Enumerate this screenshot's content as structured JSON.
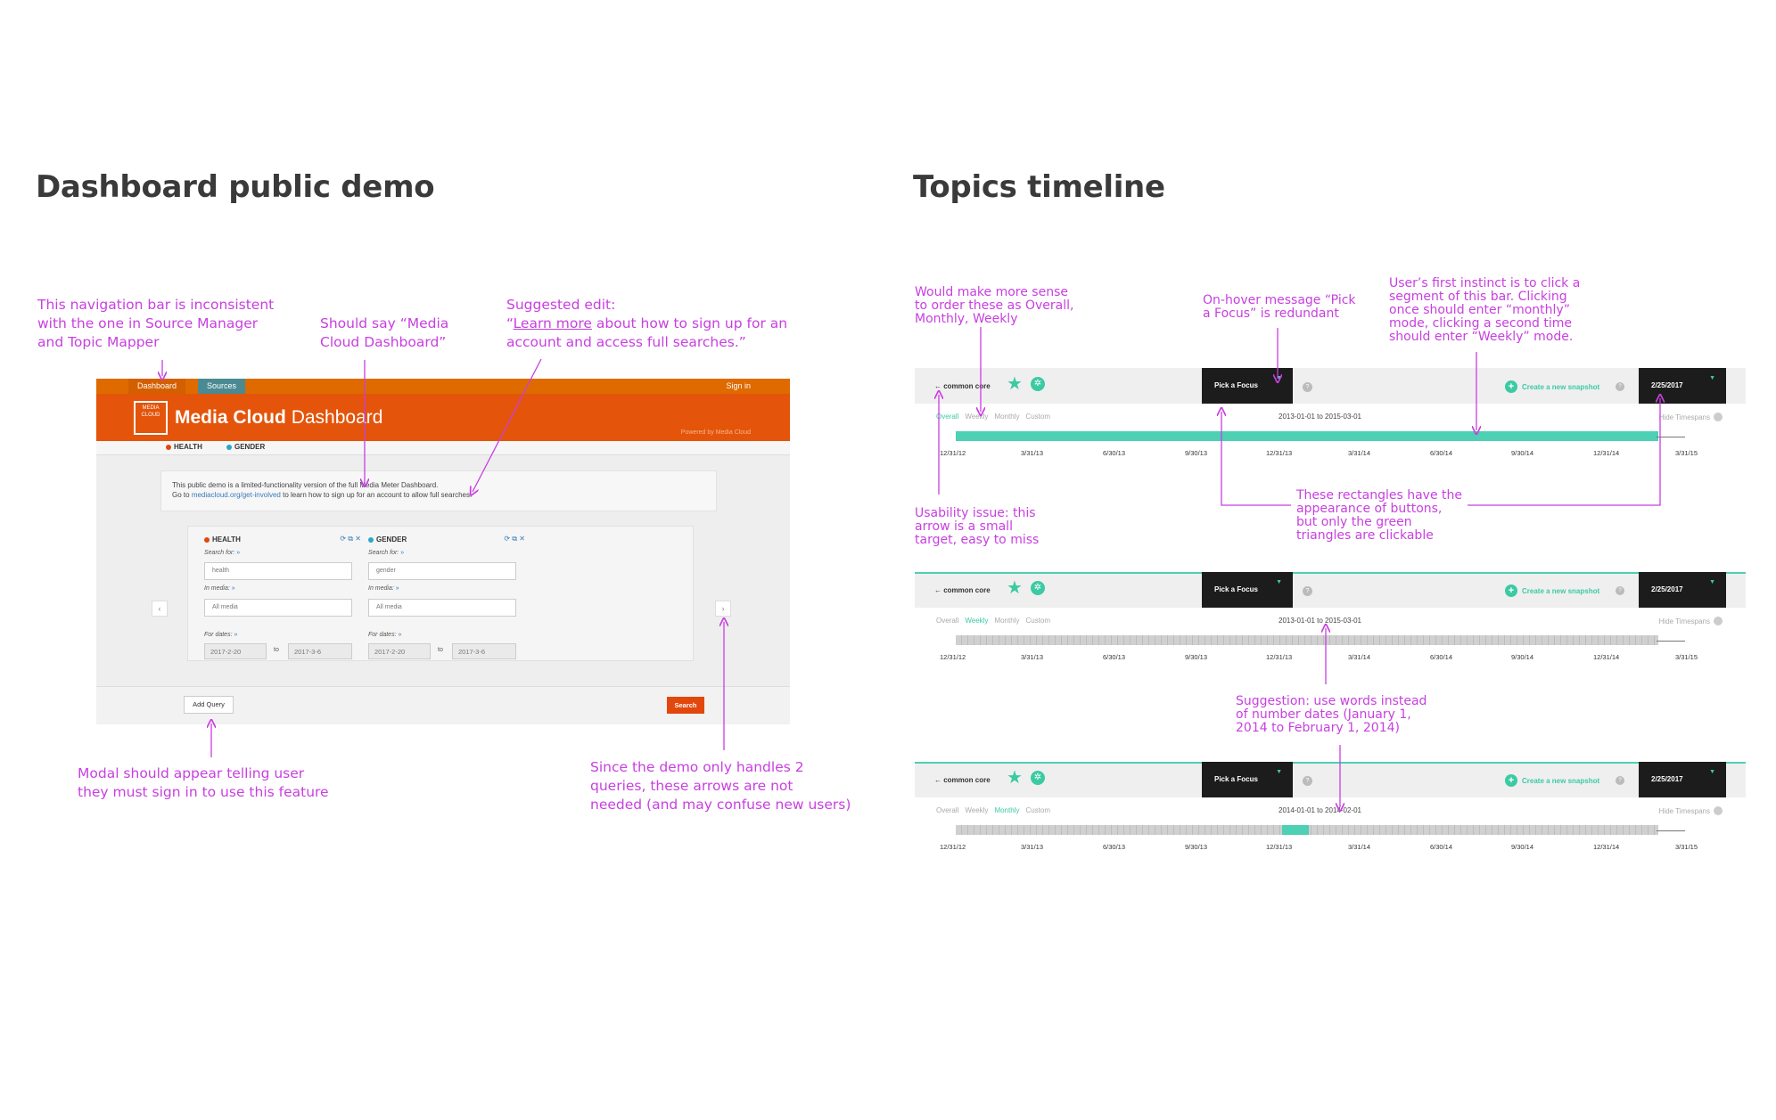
{
  "left_heading": "Dashboard public demo",
  "right_heading": "Topics timeline",
  "dashboard": {
    "nav_tabs": [
      "Dashboard",
      "Sources"
    ],
    "sign_in": "Sign in",
    "logo_text": "MEDIA CLOUD",
    "title_bold": "Media Cloud",
    "title_light": "Dashboard",
    "powered_by": "Powered by Media Cloud",
    "tags": [
      {
        "label": "HEALTH",
        "color": "#e2470c"
      },
      {
        "label": "GENDER",
        "color": "#2aa7c9"
      }
    ],
    "notice_line1": "This public demo is a limited-functionality version of the full Media Meter Dashboard.",
    "notice_go": "Go to",
    "notice_link": "mediacloud.org/get-involved",
    "notice_rest": "to learn how to sign up for an account to allow full searches.",
    "queries": [
      {
        "name": "HEALTH",
        "color": "#e2470c",
        "search_label": "Search for:",
        "search_value": "health",
        "media_label": "In media:",
        "media_value": "All media",
        "dates_label": "For dates:",
        "from": "2017-2-20",
        "to_word": "to",
        "to": "2017-3-6"
      },
      {
        "name": "GENDER",
        "color": "#2aa7c9",
        "search_label": "Search for:",
        "search_value": "gender",
        "media_label": "In media:",
        "media_value": "All media",
        "dates_label": "For dates:",
        "from": "2017-2-20",
        "to_word": "to",
        "to": "2017-3-6"
      }
    ],
    "prev_arrow": "‹",
    "next_arrow": "›",
    "add_query": "Add Query",
    "search_button": "Search"
  },
  "dash_annotations": {
    "nav": "This navigation bar is inconsistent\nwith the one in Source Manager\nand Topic Mapper",
    "title": "Should say “Media\nCloud Dashboard”",
    "edit_prefix": "Suggested edit:\n“",
    "edit_link": "Learn more",
    "edit_suffix": " about how to sign up for an\naccount and access full searches.”",
    "modal": "Modal should appear telling user\nthey must sign in to use this feature",
    "arrows": "Since the demo only handles 2\nqueries, these arrows are not\nneeded (and may confuse new users)"
  },
  "timeline": {
    "back_label": "← common core",
    "pick_focus": "Pick a Focus",
    "create_snapshot": "Create a new snapshot",
    "snapshot_date": "2/25/2017",
    "modes": [
      "Overall",
      "Weekly",
      "Monthly",
      "Custom"
    ],
    "hide_timespans": "Hide Timespans",
    "ticks": [
      "12/31/12",
      "3/31/13",
      "6/30/13",
      "9/30/13",
      "12/31/13",
      "3/31/14",
      "6/30/14",
      "9/30/14",
      "12/31/14",
      "3/31/15"
    ],
    "panels": [
      {
        "active_mode": "Overall",
        "range": "2013-01-01 to 2015-03-01",
        "bar": "solid"
      },
      {
        "active_mode": "Weekly",
        "range": "2013-01-01 to 2015-03-01",
        "bar": "segmented"
      },
      {
        "active_mode": "Monthly",
        "range": "2014-01-01 to 2014-02-01",
        "bar": "segmented-highlight"
      }
    ]
  },
  "timeline_annotations": {
    "order": "Would make more sense\nto order these as Overall,\nMonthly, Weekly",
    "hover": "On-hover message “Pick\na Focus” is redundant",
    "instinct": "User’s first instinct is to click a\nsegment of this bar. Clicking\nonce should enter “monthly”\nmode, clicking a second time\nshould enter “Weekly” mode.",
    "usability": "Usability issue: this\narrow is a small\ntarget, easy to miss",
    "rectangles": "These rectangles have the\nappearance of buttons,\nbut only the green\ntriangles are clickable",
    "suggestion": "Suggestion: use words instead\nof number dates (January 1,\n2014 to February 1, 2014)"
  },
  "colors": {
    "annotation": "#c83fe0",
    "accent_green": "#4dd0b3",
    "brand_orange": "#e4540a"
  }
}
